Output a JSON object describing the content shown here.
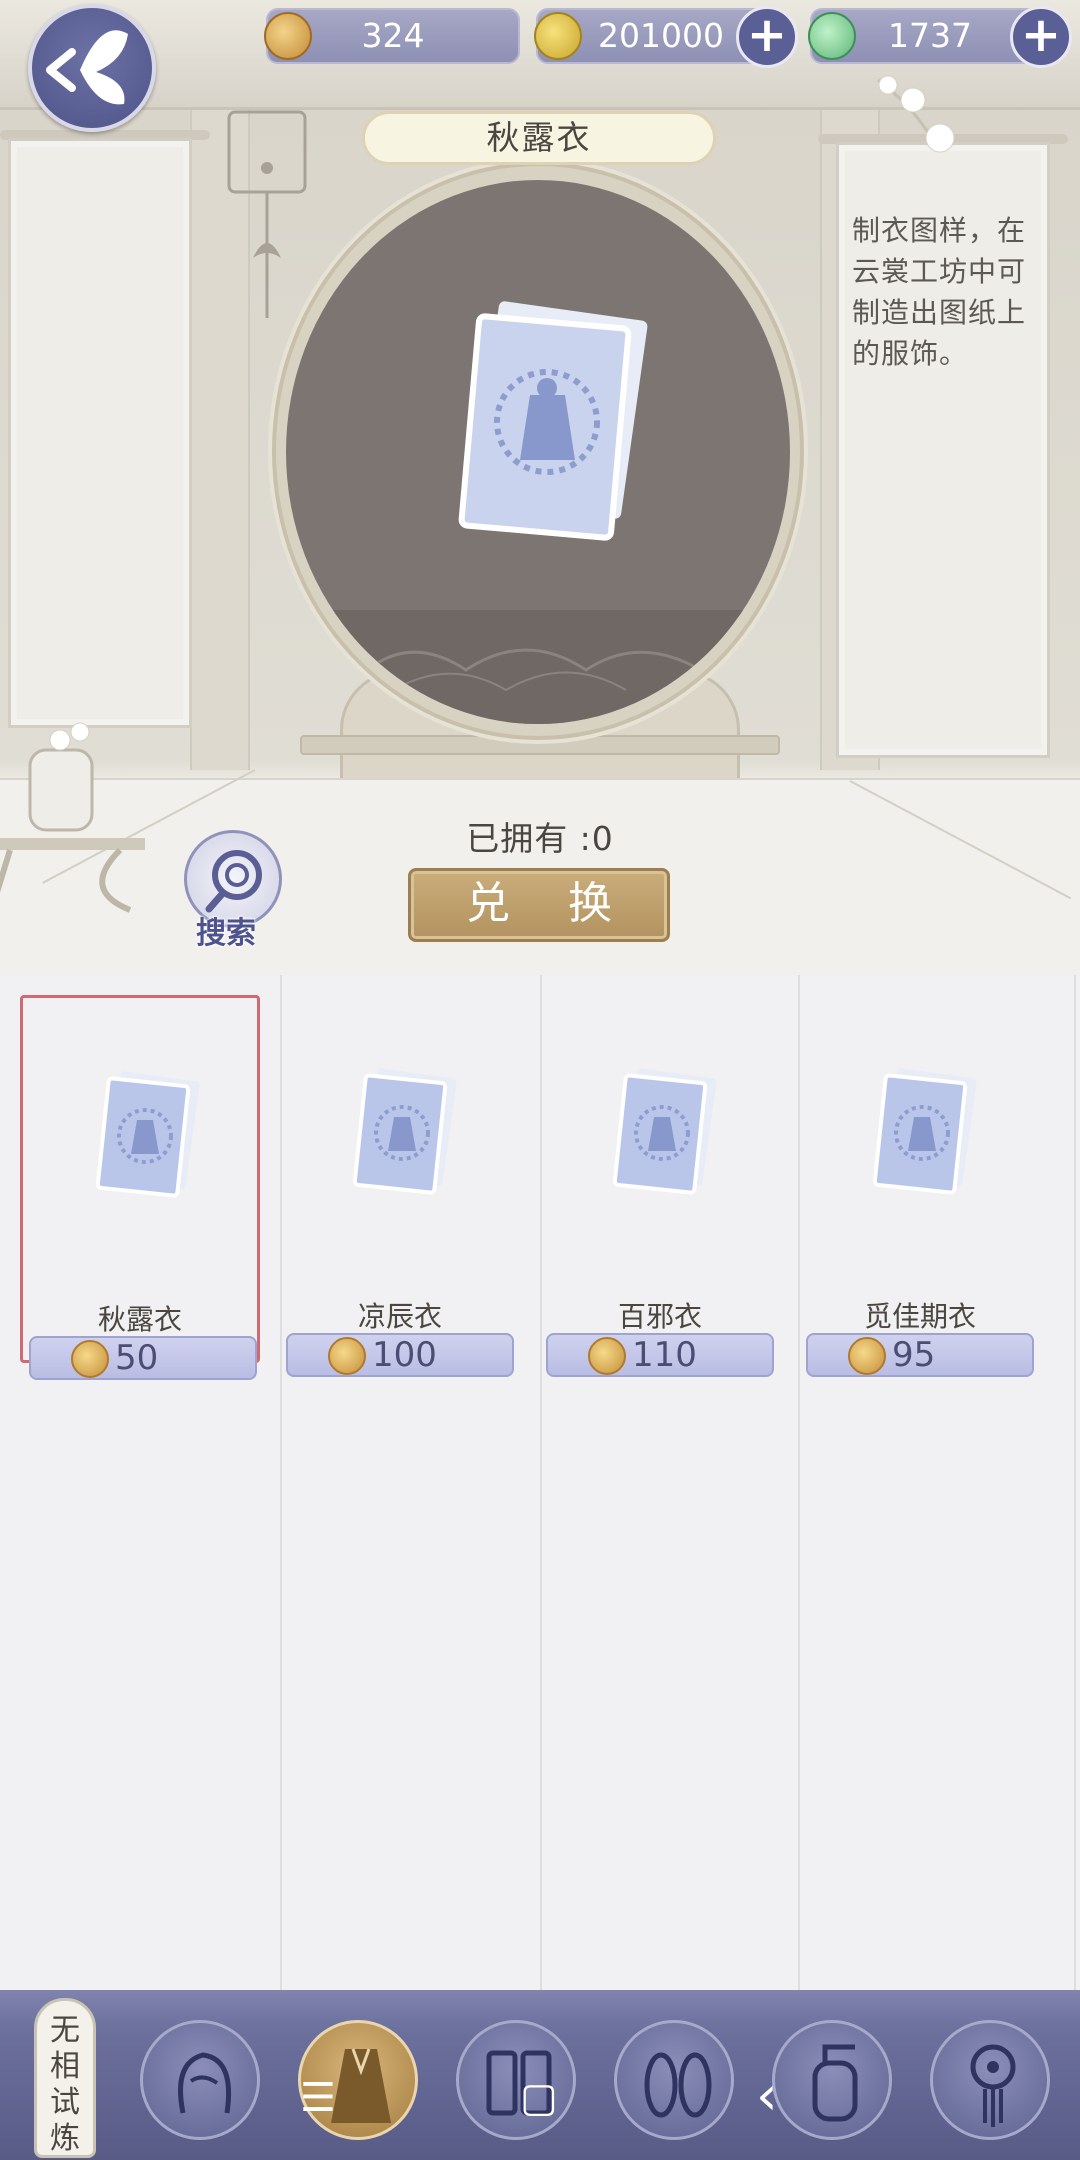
{
  "header": {
    "currencies": [
      {
        "name": "jade-token",
        "value": "324"
      },
      {
        "name": "copper-coin",
        "value": "201000"
      },
      {
        "name": "green-stone",
        "value": "1737"
      }
    ]
  },
  "preview": {
    "item_title": "秋露衣",
    "description": "制衣图样，在云裳工坊中可制造出图纸上的服饰。",
    "owned_label": "已拥有 :0",
    "exchange_label": "兑 换",
    "search_label": "搜索"
  },
  "items": [
    {
      "name": "秋露衣",
      "price": "50",
      "selected": true
    },
    {
      "name": "凉辰衣",
      "price": "100",
      "selected": false
    },
    {
      "name": "百邪衣",
      "price": "110",
      "selected": false
    },
    {
      "name": "觅佳期衣",
      "price": "95",
      "selected": false
    }
  ],
  "bottom_nav": {
    "side_tab": "无相试炼",
    "categories": [
      "hair",
      "clothing",
      "pants",
      "shoes",
      "accessory",
      "ornament"
    ],
    "active_category": "clothing"
  },
  "system_nav": {
    "menu": "☰",
    "home": "▢",
    "back": "‹"
  },
  "colors": {
    "accent": "#5a5f95",
    "exchange_button": "#bfa06c",
    "selection_border": "#d06a72",
    "price_bar": "#c4c8e8"
  }
}
